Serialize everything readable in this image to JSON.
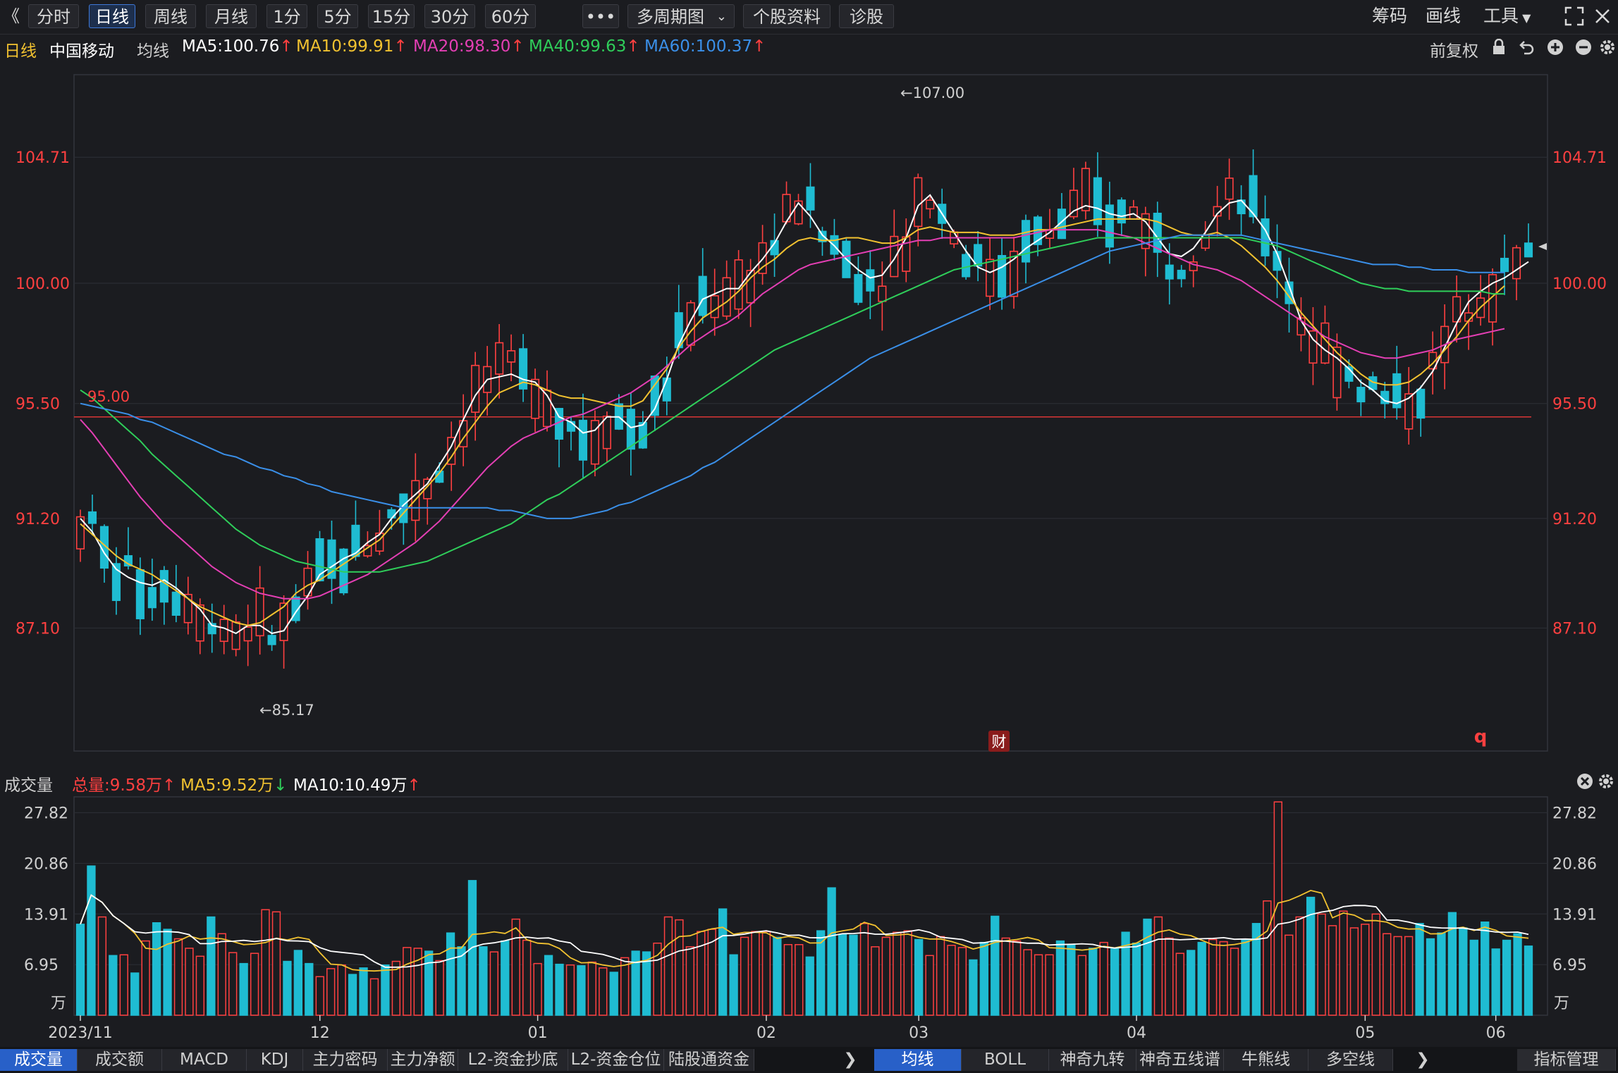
{
  "toolbar": {
    "back_glyph": "《",
    "periods": [
      "分时",
      "日线",
      "周线",
      "月线",
      "1分",
      "5分",
      "15分",
      "30分",
      "60分"
    ],
    "active_period": "日线",
    "more_label": "•••",
    "multi_period": "多周期图",
    "stock_info": "个股资料",
    "diagnose": "诊股",
    "chip": "筹码",
    "draw": "画线",
    "tools": "工具"
  },
  "info": {
    "period": "日线",
    "stock_name": "中国移动",
    "ma_label": "均线",
    "ma5": "MA5:100.76",
    "ma10": "MA10:99.91",
    "ma20": "MA20:98.30",
    "ma40": "MA40:99.63",
    "ma60": "MA60:100.37",
    "adjust": "前复权"
  },
  "volume_info": {
    "title": "成交量",
    "total": "总量:9.58万",
    "ma5": "MA5:9.52万",
    "ma10": "MA10:10.49万"
  },
  "colors": {
    "up": "#ff4040",
    "down": "#1fbcd2",
    "ma5": "#ffffff",
    "ma10": "#f2c230",
    "ma20": "#e43fb4",
    "ma40": "#2fce5a",
    "ma60": "#3a8fe8"
  },
  "chart_data": [
    {
      "type": "candlestick",
      "title": "中国移动 日线",
      "ylim": [
        82.5,
        107.8
      ],
      "y_ticks": [
        "104.71",
        "100.00",
        "95.50",
        "91.20",
        "87.10"
      ],
      "x_ticks": [
        "2023/11",
        "12",
        "01",
        "02",
        "03",
        "04",
        "05",
        "06"
      ],
      "annotations": {
        "high": "←107.00",
        "low": "←85.17",
        "line": "95.00",
        "marker_cai": "财",
        "marker_q": "q"
      },
      "series": [
        {
          "name": "MA5",
          "values": [
            91.2,
            90.7,
            89.9,
            89.3,
            89.0,
            88.8,
            88.7,
            88.9,
            88.6,
            88.2,
            87.8,
            87.2,
            87.1,
            86.9,
            87.2,
            87.2,
            86.9,
            87.0,
            87.7,
            88.3,
            89.1,
            89.4,
            89.7,
            89.9,
            90.3,
            90.6,
            91.2,
            91.7,
            92.1,
            92.5,
            93.2,
            93.9,
            94.9,
            95.8,
            96.4,
            96.5,
            96.6,
            96.4,
            96.3,
            95.8,
            95.0,
            94.8,
            94.4,
            94.5,
            95.0,
            95.0,
            94.6,
            94.7,
            95.3,
            96.4,
            97.7,
            98.6,
            99.4,
            99.6,
            99.8,
            99.8,
            100.4,
            100.9,
            101.5,
            102.3,
            103.0,
            102.5,
            101.8,
            101.4,
            100.9,
            100.5,
            100.2,
            100.3,
            100.9,
            101.7,
            102.9,
            103.3,
            102.6,
            101.9,
            101.2,
            100.6,
            100.4,
            100.6,
            100.9,
            101.3,
            101.6,
            101.9,
            102.3,
            102.7,
            102.9,
            102.8,
            102.6,
            102.5,
            102.6,
            102.3,
            101.7,
            101.1,
            101.0,
            101.3,
            101.9,
            102.6,
            103.0,
            103.1,
            102.6,
            102.0,
            101.1,
            99.9,
            98.6,
            97.9,
            97.5,
            97.2,
            96.8,
            96.3,
            96.0,
            95.6,
            95.5,
            95.7,
            96.1,
            96.7,
            97.6,
            98.5,
            99.3,
            99.7,
            100.0,
            100.2,
            100.5,
            100.8
          ]
        },
        {
          "name": "MA10",
          "values": [
            91.0,
            90.6,
            90.2,
            89.8,
            89.5,
            89.3,
            89.1,
            88.8,
            88.5,
            88.2,
            87.9,
            87.7,
            87.5,
            87.3,
            87.2,
            87.3,
            87.6,
            87.9,
            88.4,
            88.7,
            88.9,
            89.2,
            89.5,
            89.8,
            90.1,
            90.4,
            90.9,
            91.4,
            91.9,
            92.4,
            92.9,
            93.5,
            94.2,
            94.8,
            95.4,
            95.9,
            96.1,
            96.3,
            96.2,
            96.0,
            95.8,
            95.7,
            95.7,
            95.6,
            95.5,
            95.4,
            95.4,
            95.6,
            96.2,
            96.8,
            97.6,
            98.2,
            98.7,
            99.0,
            99.3,
            99.7,
            100.2,
            100.6,
            100.9,
            101.3,
            101.6,
            101.7,
            101.6,
            101.6,
            101.7,
            101.7,
            101.6,
            101.5,
            101.5,
            101.7,
            102.0,
            102.1,
            102.0,
            101.9,
            101.9,
            101.9,
            101.8,
            101.8,
            101.8,
            101.9,
            102.0,
            102.0,
            102.1,
            102.2,
            102.3,
            102.4,
            102.4,
            102.4,
            102.4,
            102.4,
            102.3,
            102.1,
            101.9,
            101.8,
            101.8,
            101.9,
            101.7,
            101.4,
            101.0,
            100.6,
            100.1,
            99.5,
            98.9,
            98.4,
            97.9,
            97.4,
            97.0,
            96.6,
            96.3,
            96.2,
            96.2,
            96.3,
            96.6,
            97.0,
            97.5,
            98.0,
            98.6,
            99.1,
            99.5,
            99.9
          ]
        },
        {
          "name": "MA20",
          "values": [
            94.9,
            94.4,
            93.8,
            93.2,
            92.6,
            92.0,
            91.5,
            91.0,
            90.6,
            90.2,
            89.8,
            89.4,
            89.1,
            88.8,
            88.6,
            88.4,
            88.3,
            88.2,
            88.2,
            88.2,
            88.3,
            88.5,
            88.7,
            88.9,
            89.1,
            89.4,
            89.7,
            90.0,
            90.3,
            90.7,
            91.1,
            91.6,
            92.1,
            92.6,
            93.1,
            93.5,
            93.9,
            94.2,
            94.4,
            94.6,
            94.8,
            95.0,
            95.1,
            95.3,
            95.5,
            95.7,
            95.9,
            96.2,
            96.5,
            96.9,
            97.3,
            97.7,
            98.0,
            98.3,
            98.5,
            98.8,
            99.2,
            99.6,
            99.9,
            100.2,
            100.5,
            100.7,
            100.8,
            100.9,
            101.0,
            101.1,
            101.2,
            101.3,
            101.4,
            101.5,
            101.6,
            101.6,
            101.7,
            101.7,
            101.7,
            101.7,
            101.7,
            101.7,
            101.7,
            101.8,
            101.9,
            102.0,
            102.0,
            102.0,
            102.0,
            102.0,
            101.9,
            101.8,
            101.7,
            101.5,
            101.3,
            101.1,
            100.9,
            100.7,
            100.6,
            100.5,
            100.3,
            100.1,
            99.8,
            99.5,
            99.2,
            98.9,
            98.6,
            98.3,
            98.0,
            97.8,
            97.6,
            97.4,
            97.3,
            97.2,
            97.2,
            97.3,
            97.4,
            97.5,
            97.7,
            97.9,
            98.0,
            98.1,
            98.2,
            98.3
          ]
        },
        {
          "name": "MA40",
          "values": [
            96.0,
            95.7,
            95.3,
            94.9,
            94.5,
            94.1,
            93.6,
            93.2,
            92.8,
            92.4,
            92.0,
            91.6,
            91.2,
            90.8,
            90.5,
            90.2,
            90.0,
            89.8,
            89.6,
            89.5,
            89.4,
            89.3,
            89.2,
            89.2,
            89.2,
            89.2,
            89.3,
            89.4,
            89.5,
            89.6,
            89.8,
            90.0,
            90.2,
            90.4,
            90.6,
            90.8,
            91.0,
            91.3,
            91.6,
            91.9,
            92.1,
            92.4,
            92.7,
            93.0,
            93.3,
            93.6,
            93.9,
            94.2,
            94.5,
            94.8,
            95.1,
            95.4,
            95.7,
            96.0,
            96.3,
            96.6,
            96.9,
            97.2,
            97.5,
            97.7,
            97.9,
            98.1,
            98.3,
            98.5,
            98.7,
            98.9,
            99.1,
            99.3,
            99.5,
            99.7,
            99.9,
            100.1,
            100.3,
            100.5,
            100.6,
            100.7,
            100.8,
            100.9,
            101.0,
            101.1,
            101.2,
            101.3,
            101.4,
            101.5,
            101.6,
            101.7,
            101.7,
            101.7,
            101.7,
            101.7,
            101.7,
            101.7,
            101.7,
            101.7,
            101.7,
            101.7,
            101.7,
            101.7,
            101.6,
            101.5,
            101.4,
            101.2,
            101.0,
            100.8,
            100.6,
            100.4,
            100.2,
            100.0,
            99.9,
            99.8,
            99.8,
            99.7,
            99.7,
            99.7,
            99.7,
            99.7,
            99.7,
            99.7,
            99.6,
            99.6
          ]
        },
        {
          "name": "MA60",
          "values": [
            95.5,
            95.4,
            95.3,
            95.2,
            95.1,
            94.9,
            94.8,
            94.6,
            94.4,
            94.2,
            94.0,
            93.8,
            93.6,
            93.5,
            93.3,
            93.1,
            93.0,
            92.8,
            92.7,
            92.5,
            92.4,
            92.2,
            92.1,
            92.0,
            91.9,
            91.8,
            91.7,
            91.6,
            91.6,
            91.6,
            91.6,
            91.6,
            91.6,
            91.6,
            91.6,
            91.5,
            91.5,
            91.4,
            91.3,
            91.2,
            91.2,
            91.2,
            91.3,
            91.4,
            91.5,
            91.7,
            91.8,
            92.0,
            92.2,
            92.4,
            92.6,
            92.8,
            93.1,
            93.3,
            93.6,
            93.9,
            94.2,
            94.5,
            94.8,
            95.1,
            95.4,
            95.7,
            96.0,
            96.3,
            96.6,
            96.9,
            97.2,
            97.4,
            97.6,
            97.8,
            98.0,
            98.2,
            98.4,
            98.6,
            98.8,
            99.0,
            99.2,
            99.4,
            99.6,
            99.8,
            100.0,
            100.2,
            100.4,
            100.6,
            100.8,
            101.0,
            101.2,
            101.3,
            101.4,
            101.5,
            101.6,
            101.7,
            101.8,
            101.8,
            101.8,
            101.8,
            101.8,
            101.8,
            101.7,
            101.6,
            101.5,
            101.4,
            101.3,
            101.2,
            101.1,
            101.0,
            100.9,
            100.8,
            100.7,
            100.7,
            100.7,
            100.6,
            100.6,
            100.5,
            100.5,
            100.5,
            100.4,
            100.4,
            100.4,
            100.4
          ]
        }
      ]
    },
    {
      "type": "bar",
      "title": "成交量",
      "unit": "万",
      "ylim": [
        0,
        30
      ],
      "y_ticks": [
        "27.82",
        "20.86",
        "13.91",
        "6.95"
      ],
      "values": [
        12.5,
        20.5,
        13.5,
        8.2,
        8.3,
        5.8,
        10.2,
        12.7,
        11.8,
        10.5,
        9.2,
        8.1,
        13.5,
        11.2,
        8.6,
        7.1,
        8.5,
        14.5,
        14.2,
        7.4,
        8.9,
        7.1,
        5.3,
        6.4,
        6.9,
        5.6,
        6.5,
        5.0,
        6.9,
        7.4,
        9.3,
        9.2,
        8.8,
        7.5,
        11.3,
        9.4,
        18.5,
        9.4,
        8.7,
        10.2,
        13.2,
        10.3,
        7.1,
        8.2,
        7.0,
        6.9,
        6.8,
        7.3,
        6.5,
        5.9,
        7.9,
        8.8,
        8.7,
        9.9,
        13.5,
        13.1,
        9.4,
        11.5,
        11.8,
        14.6,
        8.3,
        10.7,
        11.5,
        11.5,
        10.7,
        9.7,
        9.7,
        8.0,
        11.6,
        17.5,
        11.1,
        11.0,
        12.6,
        9.4,
        10.7,
        11.4,
        11.6,
        10.4,
        8.2,
        10.8,
        9.6,
        9.3,
        7.6,
        10.0,
        13.6,
        10.6,
        10.2,
        9.0,
        8.3,
        8.3,
        10.2,
        9.7,
        8.2,
        9.2,
        10.0,
        9.1,
        11.4,
        9.9,
        13.2,
        13.5,
        10.6,
        8.5,
        8.9,
        10.0,
        10.4,
        10.1,
        9.2,
        10.3,
        12.6,
        15.7,
        29.3,
        11.0,
        13.5,
        16.2,
        13.9,
        12.3,
        14.3,
        12.0,
        12.5,
        13.9,
        11.2,
        10.8,
        10.8,
        12.6,
        10.5,
        11.3,
        14.1,
        12.0,
        10.3,
        12.8,
        9.1,
        10.3,
        11.2,
        9.5
      ]
    }
  ],
  "volume_axis": {
    "unit_label": "万"
  },
  "bottom_tabs": {
    "left": [
      "成交量",
      "成交额",
      "MACD",
      "KDJ",
      "主力密码",
      "主力净额",
      "L2-资金抄底",
      "L2-资金仓位",
      "陆股通资金"
    ],
    "left_active": "成交量",
    "right": [
      "均线",
      "BOLL",
      "神奇九转",
      "神奇五线谱",
      "牛熊线",
      "多空线"
    ],
    "right_active": "均线",
    "manage": "指标管理"
  }
}
